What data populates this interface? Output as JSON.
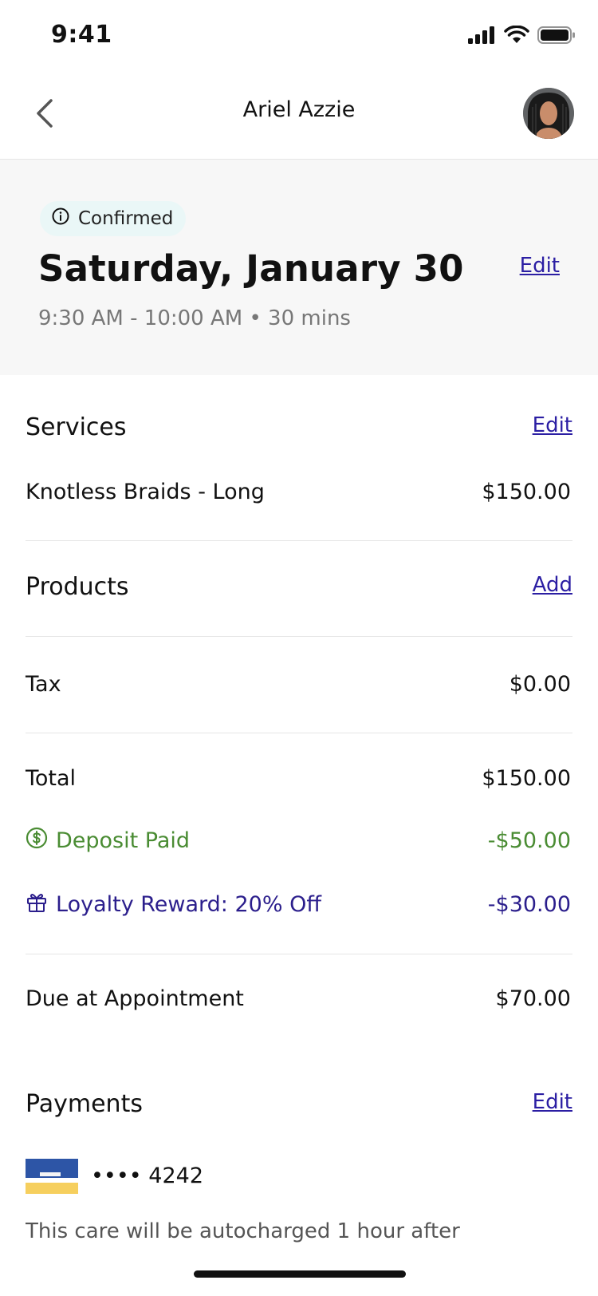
{
  "status_bar": {
    "time": "9:41",
    "icons": [
      "signal-icon",
      "wifi-icon",
      "battery-icon"
    ]
  },
  "nav": {
    "title": "Ariel Azzie",
    "back_icon": "chevron-left-icon"
  },
  "appointment": {
    "status": "Confirmed",
    "status_icon": "info-icon",
    "date": "Saturday, January 30",
    "edit_label": "Edit",
    "time_range": "9:30 AM - 10:00 AM • 30 mins"
  },
  "services": {
    "title": "Services",
    "edit_label": "Edit",
    "items": [
      {
        "name": "Knotless Braids - Long",
        "price": "$150.00"
      }
    ]
  },
  "products": {
    "title": "Products",
    "add_label": "Add"
  },
  "tax": {
    "label": "Tax",
    "value": "$0.00"
  },
  "totals": {
    "total_label": "Total",
    "total_value": "$150.00",
    "deposit_label": "Deposit Paid",
    "deposit_value": "-$50.00",
    "loyalty_label": "Loyalty Reward: 20% Off",
    "loyalty_value": "-$30.00",
    "due_label": "Due at Appointment",
    "due_value": "$70.00"
  },
  "payments": {
    "title": "Payments",
    "edit_label": "Edit",
    "card_number": "•••• 4242",
    "note": "This care will be autocharged 1 hour after"
  },
  "colors": {
    "link": "#2b1ea3",
    "deposit": "#4a8c33",
    "loyalty": "#2b1e8c",
    "badge_bg": "#eaf7f7",
    "hero_bg": "#f7f7f7"
  }
}
